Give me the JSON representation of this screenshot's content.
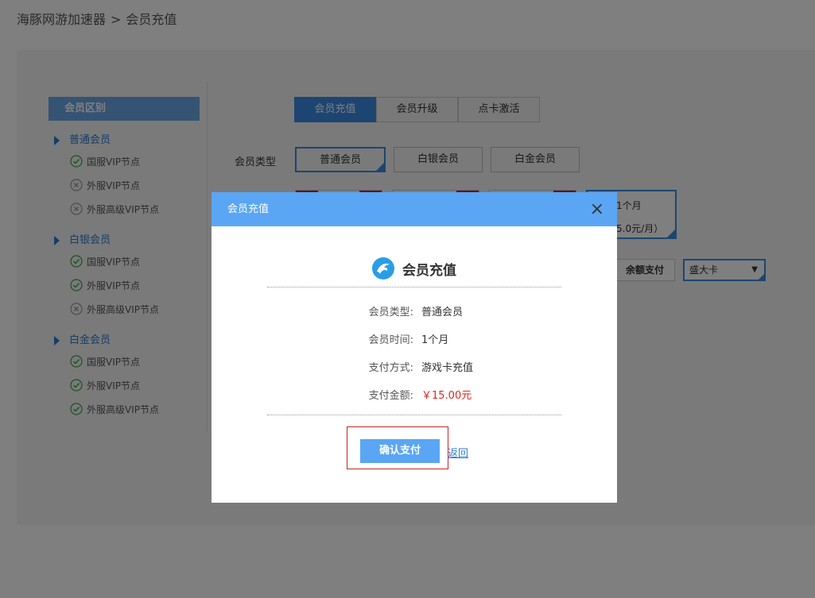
{
  "breadcrumb": {
    "root": "海豚网游加速器",
    "sep": ">",
    "current": "会员充值"
  },
  "sidebar": {
    "header": "会员区别",
    "tiers": [
      {
        "title": "普通会员",
        "nodes": [
          {
            "label": "国服VIP节点",
            "status": "check"
          },
          {
            "label": "外服VIP节点",
            "status": "cross"
          },
          {
            "label": "外服高级VIP节点",
            "status": "cross"
          }
        ]
      },
      {
        "title": "白银会员",
        "nodes": [
          {
            "label": "国服VIP节点",
            "status": "check"
          },
          {
            "label": "外服VIP节点",
            "status": "check"
          },
          {
            "label": "外服高级VIP节点",
            "status": "cross"
          }
        ]
      },
      {
        "title": "白金会员",
        "nodes": [
          {
            "label": "国服VIP节点",
            "status": "check"
          },
          {
            "label": "外服VIP节点",
            "status": "check"
          },
          {
            "label": "外服高级VIP节点",
            "status": "check"
          }
        ]
      }
    ]
  },
  "tabs": [
    {
      "label": "会员充值",
      "active": true
    },
    {
      "label": "会员升级",
      "active": false
    },
    {
      "label": "点卡激活",
      "active": false
    }
  ],
  "member_type": {
    "label": "会员类型",
    "options": [
      {
        "label": "普通会员",
        "selected": true
      },
      {
        "label": "白银会员",
        "selected": false
      },
      {
        "label": "白金会员",
        "selected": false
      }
    ]
  },
  "duration": {
    "selected_label": "1个月",
    "selected_price": "5.0元/月）"
  },
  "payment": {
    "balance_label": "余额支付",
    "select_value": "盛大卡",
    "select_arrow": "▼"
  },
  "modal": {
    "header": "会员充值",
    "close": "×",
    "title": "会员充值",
    "rows": [
      {
        "label": "会员类型:",
        "value": "普通会员"
      },
      {
        "label": "会员时间:",
        "value": "1个月"
      },
      {
        "label": "支付方式:",
        "value": "游戏卡充值"
      },
      {
        "label": "支付金额:",
        "value": "￥15.00元"
      }
    ],
    "confirm_label": "确认支付",
    "back_label": "返回"
  },
  "colors": {
    "accent": "#3b8ae2",
    "modal_header": "#5aa6f4",
    "price_red": "#e0271f",
    "highlight_frame": "#c1272d"
  }
}
